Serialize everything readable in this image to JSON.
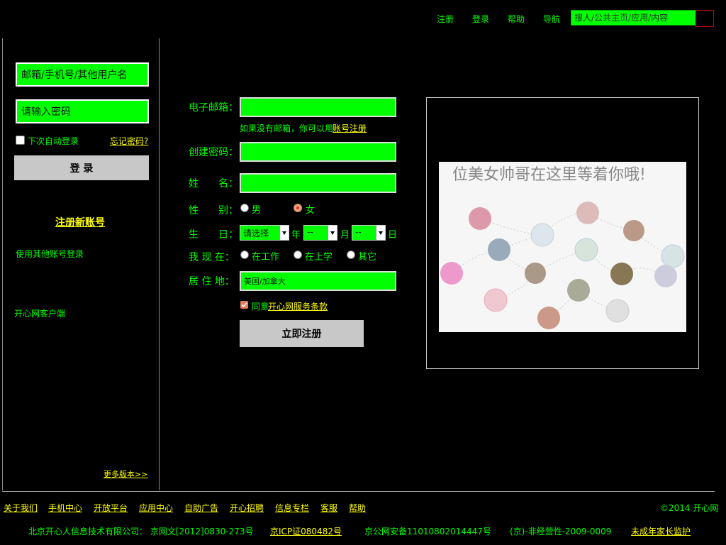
{
  "topnav": {
    "links": [
      "注册",
      "登录",
      "帮助",
      "导航"
    ],
    "search_placeholder": "搜人/公共主页/应用/内容"
  },
  "login": {
    "username_value": "邮箱/手机号/其他用户名",
    "password_value": "请输入密码",
    "remember_label": "下次自动登录",
    "forgot_label": "忘记密码?",
    "login_button": "登 录",
    "register_new": "注册新账号",
    "other_accounts": "使用其他账号登录",
    "client_link": "开心网客户端",
    "more_versions": "更多版本>>"
  },
  "form": {
    "email_label": "电子邮箱：",
    "email_hint_text": "如果没有邮箱，你可以用",
    "email_hint_link": "账号注册",
    "password_label": "创建密码：",
    "name_label": "姓　　名：",
    "gender_label": "性　　别：",
    "gender_options": [
      "男",
      "女"
    ],
    "gender_selected": "女",
    "birthday_label": "生　　日：",
    "birthday_year": "请选择",
    "birthday_year_unit": "年",
    "birthday_month": "--",
    "birthday_month_unit": "月",
    "birthday_day": "--",
    "birthday_day_unit": "日",
    "status_label": "我 现 在：",
    "status_options": [
      "在工作",
      "在上学",
      "其它"
    ],
    "residence_label": "居 住 地：",
    "residence_value": "美国/加拿大",
    "agree_text": "同意",
    "agree_link": "开心网服务条款",
    "submit_button": "立即注册"
  },
  "promo": {
    "caption": "位美女帅哥在这里等着你哦!"
  },
  "footer": {
    "links": [
      "关于我们",
      "手机中心",
      "开放平台",
      "应用中心",
      "自助广告",
      "开心招聘",
      "信息专栏",
      "客服",
      "帮助"
    ],
    "copyright": "©2014 开心网",
    "company": "北京开心人信息技术有限公司： 京网文[2012]0830-273号",
    "icp": "京ICP证080482号",
    "police": "京公网安备11010802014447号",
    "license": "(京)-非经营性-2009-0009",
    "guardian": "未成年家长监护"
  },
  "colors": {
    "background": "#000000",
    "text_green": "#00ff00",
    "link_yellow": "#ffff00",
    "input_green": "#00ff00",
    "button_gray": "#c8c8c8"
  }
}
